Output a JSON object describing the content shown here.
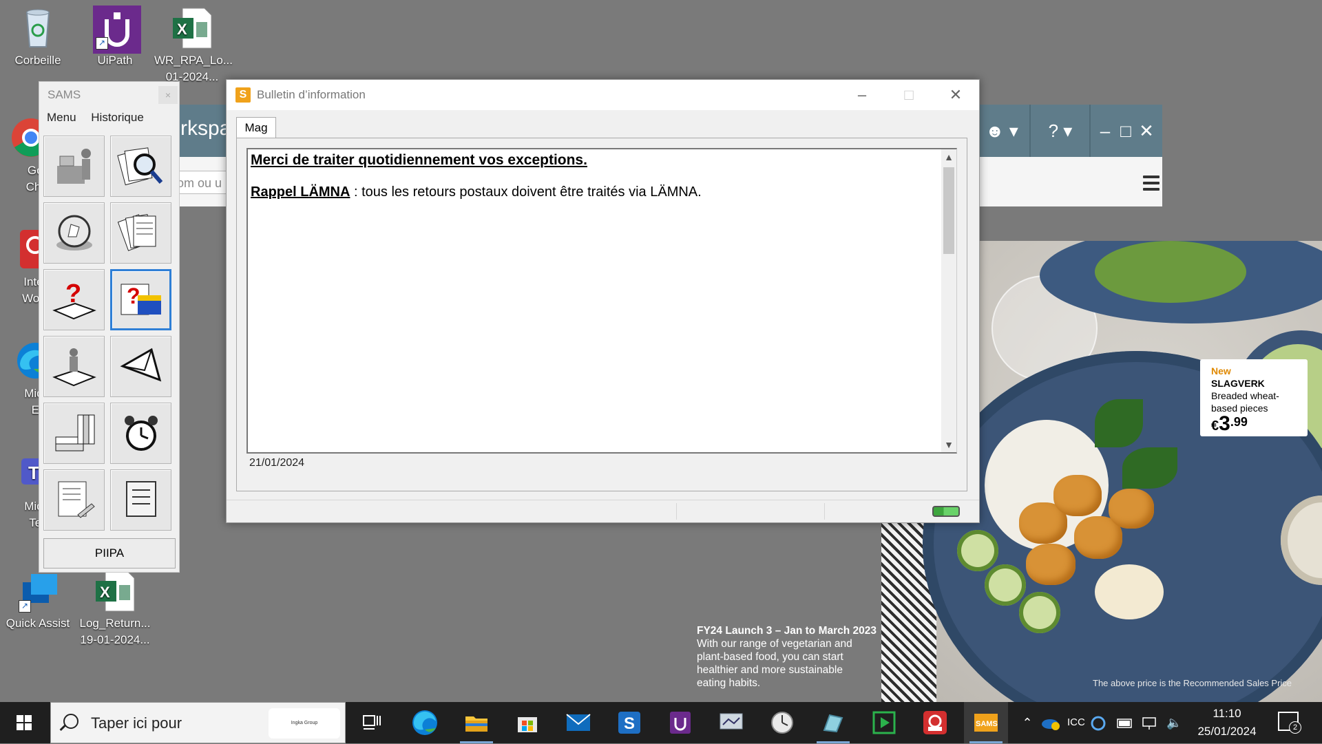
{
  "desktop": {
    "icons": [
      {
        "label": "Corbeille",
        "icon": "recycle-bin-icon"
      },
      {
        "label": "UiPath",
        "icon": "uipath-icon"
      },
      {
        "label": "WR_RPA_Lo...",
        "label2": "01-2024...",
        "icon": "excel-file-icon"
      },
      {
        "label": "Goo",
        "label2": "Chro",
        "icon": "chrome-icon"
      },
      {
        "label": "Intera",
        "label2": "Works",
        "icon": "interaction-workspace-icon"
      },
      {
        "label": "Micro",
        "label2": "Ed",
        "icon": "edge-icon"
      },
      {
        "label": "Micro",
        "label2": "Tea",
        "icon": "teams-icon"
      },
      {
        "label": "Quick Assist",
        "icon": "quick-assist-icon"
      },
      {
        "label": "Log_Return...",
        "label2": "19-01-2024...",
        "icon": "excel-file-icon"
      }
    ]
  },
  "wallpaper": {
    "promo": {
      "new": "New",
      "name": "SLAGVERK",
      "desc1": "Breaded wheat-",
      "desc2": "based pieces",
      "currency": "€",
      "price_big": "3",
      "price_cents": ".99"
    },
    "caption_title": "FY24 Launch 3 – Jan to March 2023",
    "caption_lines": [
      "With our range of vegetarian and",
      "plant-based food, you can start",
      "healthier and more sustainable",
      "eating habits."
    ],
    "rrp": "The above price is the Recommended Sales Price"
  },
  "bg_app": {
    "title_fragment": "rkspa",
    "search_fragment": "om ou u"
  },
  "sams": {
    "title": "SAMS",
    "close": "×",
    "menu": [
      "Menu",
      "Historique"
    ],
    "tiles": [
      "cashier-icon",
      "document-search-icon",
      "ticket-lookup-icon",
      "documents-stack-icon",
      "question-box-icon",
      "store-question-icon",
      "person-platform-icon",
      "envelope-icon",
      "books-icon",
      "alarm-clock-icon",
      "report-pencil-icon",
      "note-card-icon"
    ],
    "piipa": "PIIPA"
  },
  "dialog": {
    "app_letter": "S",
    "title": "Bulletin d’information",
    "tab": "Mag",
    "line1": "Merci de traiter quotidiennement vos exceptions.",
    "line2_bold": "Rappel LÄMNA",
    "line2_rest": " : tous les retours postaux doivent être traités via LÄMNA.",
    "date": "21/01/2024"
  },
  "taskbar": {
    "search_placeholder": "Taper ici pour",
    "search_badge": "Ingka Group",
    "apps": [
      "task-view-icon",
      "edge-icon",
      "file-explorer-icon",
      "store-icon",
      "mail-icon",
      "sams-s-icon",
      "uipath-icon",
      "monitor-icon",
      "clock-app-icon",
      "tablet-icon",
      "player-icon",
      "headset-icon",
      "sams-app-icon"
    ],
    "tray_lang": "ICC",
    "time": "11:10",
    "date": "25/01/2024",
    "notif_count": "2"
  }
}
